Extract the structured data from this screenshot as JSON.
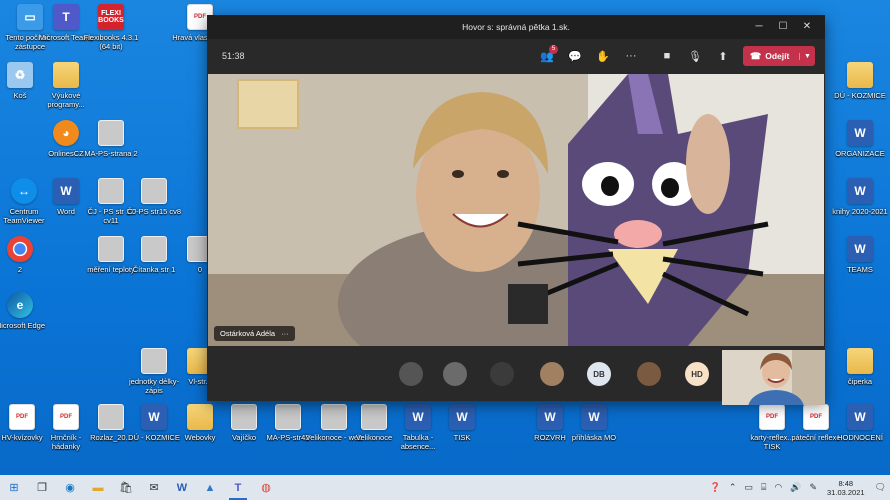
{
  "desktop": {
    "icons": [
      {
        "label": "Tento počítač - zástupce",
        "icon": "computer-icon",
        "kind": "pc"
      },
      {
        "label": "Microsoft Teams",
        "icon": "teams-icon",
        "kind": "teams"
      },
      {
        "label": "Flexibooks 4.3.1 (64 bit)",
        "icon": "flexibooks-icon",
        "kind": "flexi",
        "glyph": "FLEXI BOOKS"
      },
      {
        "label": "Hravá vlastivěda",
        "icon": "pdf-icon",
        "kind": "pdf"
      },
      {
        "label": "Koš",
        "icon": "recycle-bin-icon",
        "kind": "bin"
      },
      {
        "label": "Výukové programy...",
        "icon": "folder-icon",
        "kind": "folder"
      },
      {
        "label": "OnlinesCZ",
        "icon": "owl-icon",
        "kind": "owl"
      },
      {
        "label": "MA-PS-strana 2",
        "icon": "image-icon",
        "kind": "img"
      },
      {
        "label": "Centrum TeamViewer",
        "icon": "teamviewer-icon",
        "kind": "tv"
      },
      {
        "label": "Word",
        "icon": "word-icon",
        "kind": "word"
      },
      {
        "label": "ČJ - PS str 17 cv11",
        "icon": "image-icon",
        "kind": "img"
      },
      {
        "label": "ČJ-PS str15 cv8",
        "icon": "image-icon",
        "kind": "img"
      },
      {
        "label": "2",
        "icon": "chrome-icon",
        "kind": "chrome"
      },
      {
        "label": "měření teploty",
        "icon": "image-icon",
        "kind": "img"
      },
      {
        "label": "Čítanka str 1",
        "icon": "image-icon",
        "kind": "img"
      },
      {
        "label": "0",
        "icon": "image-icon",
        "kind": "img"
      },
      {
        "label": "Microsoft Edge",
        "icon": "edge-icon",
        "kind": "edge"
      },
      {
        "label": "jednotky délky-zápis",
        "icon": "image-icon",
        "kind": "img"
      },
      {
        "label": "Vl-str...",
        "icon": "folder-icon",
        "kind": "folder"
      },
      {
        "label": "HV-kvízovky",
        "icon": "pdf-icon",
        "kind": "pdf"
      },
      {
        "label": "Hrnčník - hádanky",
        "icon": "pdf-icon",
        "kind": "pdf"
      },
      {
        "label": "Rozlaz_20...",
        "icon": "image-icon",
        "kind": "img"
      },
      {
        "label": "DÚ - KOZMICE",
        "icon": "word-icon",
        "kind": "word"
      },
      {
        "label": "Webovky",
        "icon": "folder-icon",
        "kind": "folder"
      },
      {
        "label": "Vajíčko",
        "icon": "image-icon",
        "kind": "img"
      },
      {
        "label": "MA-PS-str42",
        "icon": "image-icon",
        "kind": "img"
      },
      {
        "label": "Velikonoce - web",
        "icon": "image-icon",
        "kind": "img"
      },
      {
        "label": "Velikonoce",
        "icon": "image-icon",
        "kind": "img"
      },
      {
        "label": "Tabulka - absence...",
        "icon": "word-icon",
        "kind": "word"
      },
      {
        "label": "TISK",
        "icon": "word-icon",
        "kind": "word"
      },
      {
        "label": "ROZVRH",
        "icon": "word-icon",
        "kind": "word"
      },
      {
        "label": "přihláska MO",
        "icon": "word-icon",
        "kind": "word"
      },
      {
        "label": "karty-reflex... TISK",
        "icon": "pdf-icon",
        "kind": "pdf"
      },
      {
        "label": "páteční reflexe",
        "icon": "pdf-icon",
        "kind": "pdf"
      },
      {
        "label": "HODNOCENÍ",
        "icon": "word-icon",
        "kind": "word"
      },
      {
        "label": "DÚ - KOZMICE",
        "icon": "folder-icon",
        "kind": "folder"
      },
      {
        "label": "ORGANIZACE",
        "icon": "word-icon",
        "kind": "word"
      },
      {
        "label": "knihy 2020-2021",
        "icon": "word-icon",
        "kind": "word"
      },
      {
        "label": "TEAMS",
        "icon": "word-icon",
        "kind": "word"
      },
      {
        "label": "čiperka",
        "icon": "folder-icon",
        "kind": "folder"
      }
    ]
  },
  "teams_window": {
    "title": "Hovor s: správná pětka 1.sk.",
    "timer": "51:38",
    "participants_badge": "5",
    "leave_label": "Odejít",
    "speaker_name": "Ostárková Adéla",
    "speaker_more": "···",
    "avatars": [
      {
        "initials": "",
        "color": "#555"
      },
      {
        "initials": "",
        "color": "#6b6b6b"
      },
      {
        "initials": "",
        "color": "#3b3b3b"
      },
      {
        "initials": "",
        "color": "#a08060"
      },
      {
        "initials": "DB",
        "color": "#dfe6f0"
      },
      {
        "initials": "",
        "color": "#7a5a40"
      },
      {
        "initials": "HD",
        "color": "#f7e2c8"
      }
    ]
  },
  "taskbar": {
    "time": "8:48",
    "date": "31.03.2021"
  }
}
